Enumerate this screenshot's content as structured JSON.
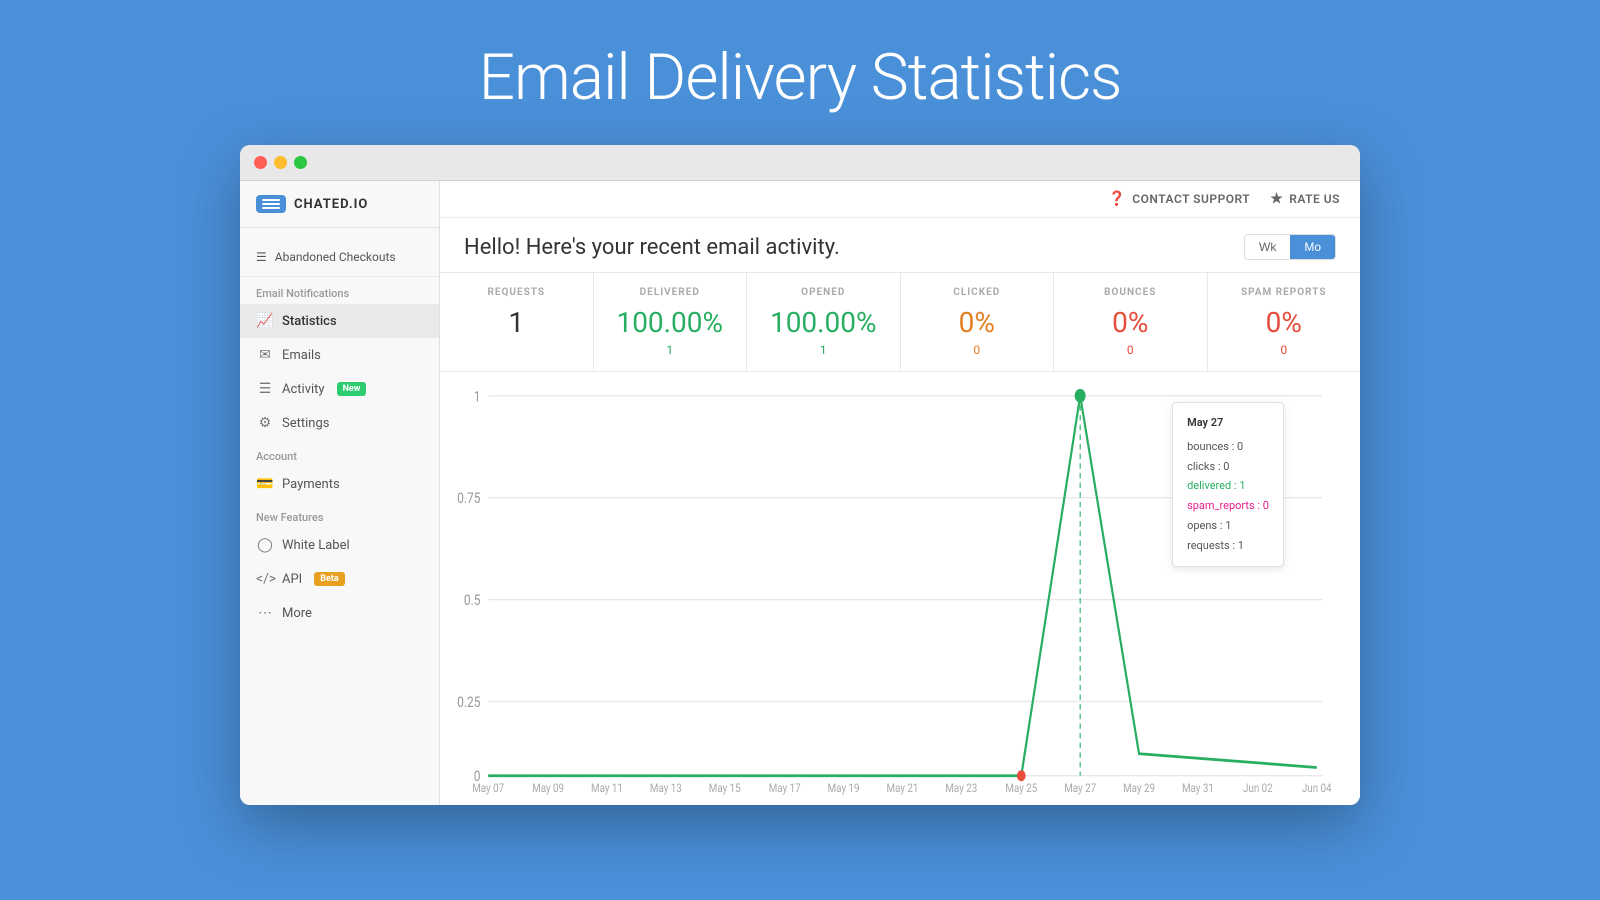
{
  "page": {
    "title": "Email Delivery Statistics",
    "background_color": "#4A90D9"
  },
  "window": {
    "traffic_lights": [
      "red",
      "yellow",
      "green"
    ]
  },
  "header": {
    "contact_support": "CONTACT SUPPORT",
    "rate_us": "RATE US"
  },
  "logo": {
    "text": "CHATED.IO",
    "icon_line1": "---",
    "icon_line2": "---"
  },
  "sidebar": {
    "top_item": {
      "label": "Abandoned Checkouts",
      "icon": "≡"
    },
    "section_label": "Email Notifications",
    "items": [
      {
        "id": "statistics",
        "label": "Statistics",
        "icon": "📈",
        "active": true
      },
      {
        "id": "emails",
        "label": "Emails",
        "icon": "✉"
      },
      {
        "id": "activity",
        "label": "Activity",
        "icon": "≡",
        "badge": "New",
        "badge_type": "new"
      },
      {
        "id": "settings",
        "label": "Settings",
        "icon": "⚙"
      }
    ],
    "account_section": "Account",
    "account_items": [
      {
        "id": "payments",
        "label": "Payments",
        "icon": "💳"
      }
    ],
    "new_features_section": "New Features",
    "new_feature_items": [
      {
        "id": "white-label",
        "label": "White Label",
        "icon": "◎"
      },
      {
        "id": "api",
        "label": "API",
        "icon": "</>",
        "badge": "Beta",
        "badge_type": "beta"
      }
    ],
    "more_item": {
      "label": "More",
      "icon": "···"
    }
  },
  "stats": {
    "heading": "Hello! Here's your recent email activity.",
    "period_wk": "Wk",
    "period_mo": "Mo",
    "cards": [
      {
        "id": "requests",
        "label": "REQUESTS",
        "value": "1",
        "sub": "",
        "color": "black"
      },
      {
        "id": "delivered",
        "label": "DELIVERED",
        "value": "100.00%",
        "sub": "1",
        "color": "green"
      },
      {
        "id": "opened",
        "label": "OPENED",
        "value": "100.00%",
        "sub": "1",
        "color": "green"
      },
      {
        "id": "clicked",
        "label": "CLICKED",
        "value": "0%",
        "sub": "0",
        "color": "orange"
      },
      {
        "id": "bounces",
        "label": "BOUNCES",
        "value": "0%",
        "sub": "0",
        "color": "red"
      },
      {
        "id": "spam_reports",
        "label": "SPAM REPORTS",
        "value": "0%",
        "sub": "0",
        "color": "red"
      }
    ]
  },
  "chart": {
    "y_labels": [
      "1",
      "0.75",
      "0.5",
      "0.25",
      "0"
    ],
    "x_labels": [
      "May 07",
      "May 09",
      "May 11",
      "May 13",
      "May 15",
      "May 17",
      "May 19",
      "May 21",
      "May 23",
      "May 25",
      "May 27",
      "May 29",
      "May 31",
      "Jun 02",
      "Jun 04"
    ],
    "tooltip": {
      "date": "May 27",
      "bounces": "bounces : 0",
      "clicks": "clicks : 0",
      "delivered": "delivered : 1",
      "spam_reports": "spam_reports : 0",
      "opens": "opens : 1",
      "requests": "requests : 1"
    }
  }
}
